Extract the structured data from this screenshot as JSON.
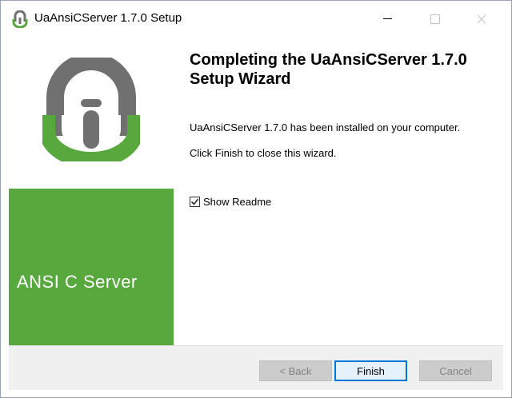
{
  "window": {
    "title": "UaAnsiCServer 1.7.0 Setup",
    "app_icon": "uaansicserver-logo-icon",
    "controls": {
      "minimize_icon": "minimize-icon",
      "maximize_icon": "maximize-icon",
      "close_icon": "close-icon"
    }
  },
  "sidebar": {
    "logo": "ua-logo",
    "product_label": "ANSI C Server",
    "colors": {
      "green": "#58a93d",
      "logo_gray": "#707070"
    }
  },
  "main": {
    "heading": "Completing the UaAnsiCServer 1.7.0 Setup Wizard",
    "installed_text": "UaAnsiCServer 1.7.0 has been installed on your computer.",
    "close_text": "Click Finish to close this wizard.",
    "show_readme": {
      "label": "Show Readme",
      "checked": true
    }
  },
  "footer": {
    "back_label": "< Back",
    "finish_label": "Finish",
    "cancel_label": "Cancel",
    "accent": "#0078d7"
  }
}
